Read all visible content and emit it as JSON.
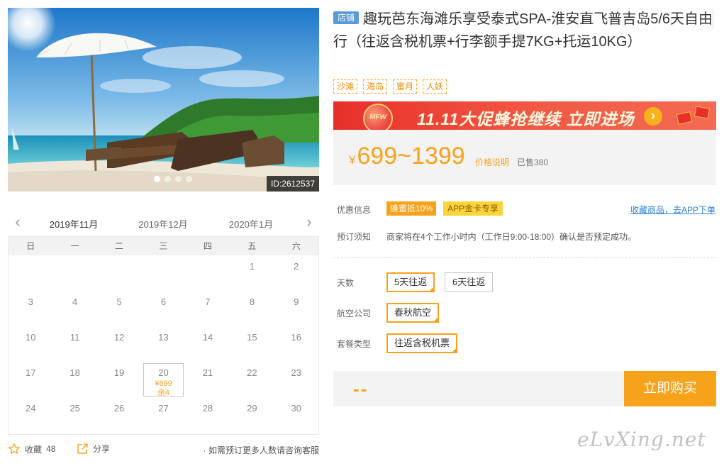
{
  "photo": {
    "id_label": "ID:2612537",
    "slides": 4,
    "active_slide": 0
  },
  "calendar": {
    "months": [
      "2019年11月",
      "2019年12月",
      "2020年1月"
    ],
    "active_month": 0,
    "weekdays": [
      "日",
      "一",
      "二",
      "三",
      "四",
      "五",
      "六"
    ],
    "days": [
      "",
      "",
      "",
      "",
      "",
      "1",
      "2",
      "3",
      "4",
      "5",
      "6",
      "7",
      "8",
      "9",
      "10",
      "11",
      "12",
      "13",
      "14",
      "15",
      "16",
      "17",
      "18",
      "19",
      "20",
      "21",
      "22",
      "23",
      "24",
      "25",
      "26",
      "27",
      "28",
      "29",
      "30"
    ],
    "selected": {
      "day": "20",
      "price": "¥699",
      "stock": "余4"
    }
  },
  "actions": {
    "favorite_label": "收藏",
    "favorite_count": "48",
    "share_label": "分享",
    "consult_text": "· 如需预订更多人数请咨询客服"
  },
  "product": {
    "shop_badge": "店铺",
    "title": "趣玩芭东海滩乐享受泰式SPA-淮安直飞普吉岛5/6天自由行（往返含税机票+行李额手提7KG+托运10KG）",
    "tags": [
      "沙滩",
      "海岛",
      "蜜月",
      "人妖"
    ]
  },
  "promo": {
    "text": "11.11大促蜂抢继续 立即进场",
    "balloon": "MFW"
  },
  "price": {
    "currency": "¥",
    "range": "699~1399",
    "note": "价格说明",
    "sold": "已售380"
  },
  "offers": {
    "label": "优惠信息",
    "badges": [
      "蜂蜜抵10%",
      "APP金卡专享"
    ],
    "app_link": "收藏商品，去APP下单"
  },
  "booking": {
    "label": "预订须知",
    "text": "商家将在4个工作小时内（工作日9:00-18:00）确认是否预定成功。"
  },
  "options": [
    {
      "label": "天数",
      "values": [
        "5天往返",
        "6天往返"
      ],
      "selected": 0
    },
    {
      "label": "航空公司",
      "values": [
        "春秋航空"
      ],
      "selected": 0
    },
    {
      "label": "套餐类型",
      "values": [
        "往返含税机票"
      ],
      "selected": 0
    }
  ],
  "purchase": {
    "total": "--",
    "button": "立即购买"
  },
  "watermark": "eLvXing.net",
  "colors": {
    "accent": "#f7a21b",
    "promo": "#e8302a",
    "link": "#2a7fd4"
  }
}
